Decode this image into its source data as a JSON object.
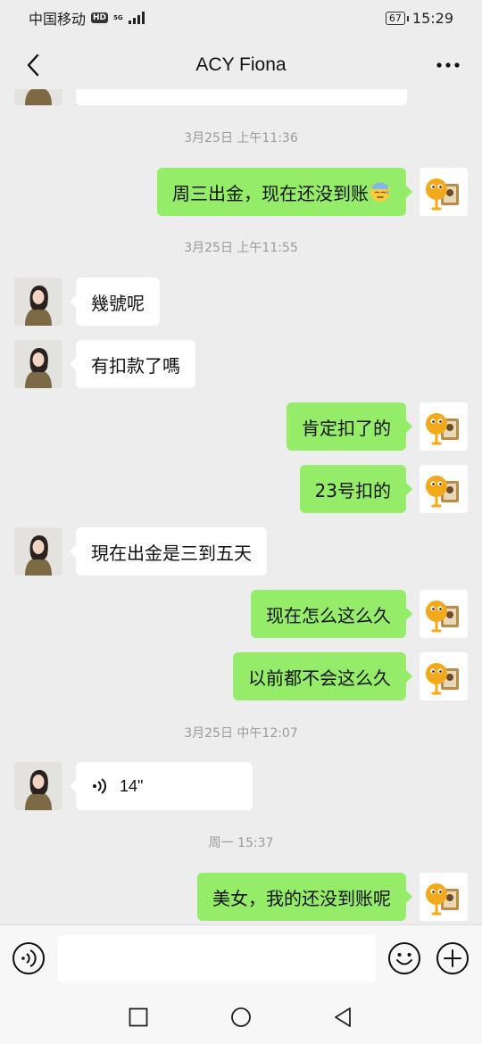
{
  "status_bar": {
    "carrier": "中国移动",
    "hd": "HD",
    "network": "5G",
    "battery": "67",
    "time": "15:29"
  },
  "header": {
    "title": "ACY Fiona",
    "back_icon": "chevron-left-icon",
    "more_icon": "more-horizontal-icon"
  },
  "messages": [
    {
      "kind": "time",
      "text": "3月25日 上午11:36"
    },
    {
      "kind": "me",
      "text": "周三出金，现在还没到账",
      "emoji": "cold-sweat-emoji"
    },
    {
      "kind": "time",
      "text": "3月25日 上午11:55"
    },
    {
      "kind": "other",
      "text": "幾號呢"
    },
    {
      "kind": "other",
      "text": "有扣款了嗎"
    },
    {
      "kind": "me",
      "text": "肯定扣了的"
    },
    {
      "kind": "me",
      "text": "23号扣的"
    },
    {
      "kind": "other",
      "text": "現在出金是三到五天"
    },
    {
      "kind": "me",
      "text": "现在怎么这么久"
    },
    {
      "kind": "me",
      "text": "以前都不会这么久"
    },
    {
      "kind": "time",
      "text": "3月25日 中午12:07"
    },
    {
      "kind": "other_voice",
      "duration": "14\""
    },
    {
      "kind": "time",
      "text": "周一 15:37"
    },
    {
      "kind": "me",
      "text": "美女，我的还没到账呢"
    }
  ],
  "input_bar": {
    "voice_icon": "voice-input-icon",
    "text_value": "",
    "emoji_icon": "emoji-icon",
    "plus_icon": "plus-icon"
  },
  "system_nav": {
    "recent_icon": "recent-apps-icon",
    "home_icon": "home-icon",
    "back_icon": "back-triangle-icon"
  },
  "colors": {
    "background": "#ededed",
    "my_bubble": "#95ec69",
    "other_bubble": "#ffffff",
    "timestamp": "#9a9a9a"
  }
}
